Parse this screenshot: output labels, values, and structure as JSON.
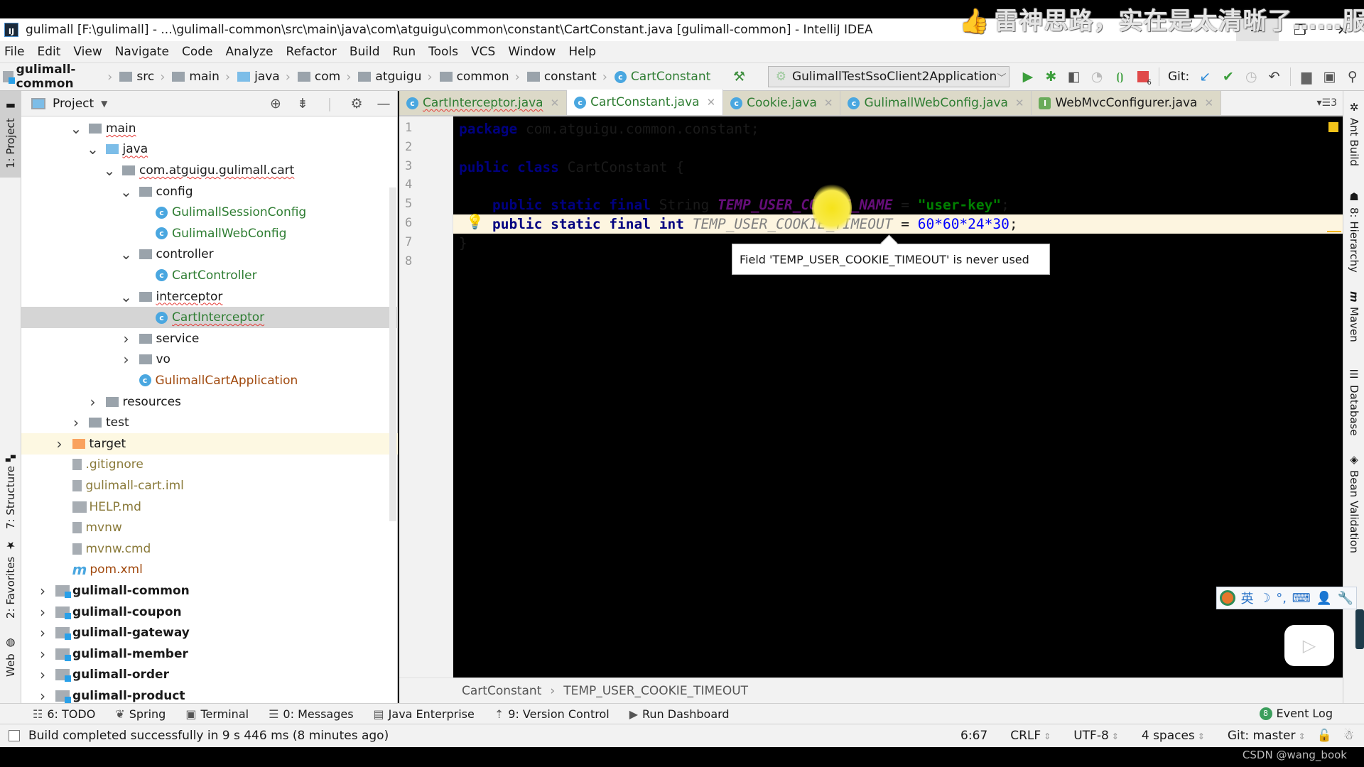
{
  "watermark": {
    "text": "雷神思路，实在是太清晰了……服了"
  },
  "window": {
    "title": "gulimall [F:\\gulimall] - ...\\gulimall-common\\src\\main\\java\\com\\atguigu\\common\\constant\\CartConstant.java [gulimall-common] - IntelliJ IDEA",
    "logo": "IJ"
  },
  "menu": [
    "File",
    "Edit",
    "View",
    "Navigate",
    "Code",
    "Analyze",
    "Refactor",
    "Build",
    "Run",
    "Tools",
    "VCS",
    "Window",
    "Help"
  ],
  "breadcrumbs": [
    {
      "label": "gulimall-common",
      "icon": "module-icon"
    },
    {
      "label": "src",
      "icon": "folder-icon"
    },
    {
      "label": "main",
      "icon": "folder-icon"
    },
    {
      "label": "java",
      "icon": "source-folder-icon"
    },
    {
      "label": "com",
      "icon": "package-icon"
    },
    {
      "label": "atguigu",
      "icon": "package-icon"
    },
    {
      "label": "common",
      "icon": "package-icon"
    },
    {
      "label": "constant",
      "icon": "package-icon"
    },
    {
      "label": "CartConstant",
      "icon": "class-icon"
    }
  ],
  "toolbar": {
    "run_config": "GulimallTestSsoClient2Application",
    "git_label": "Git:",
    "stop_badge": "6"
  },
  "left_stripe": [
    "1: Project",
    "7: Structure",
    "2: Favorites",
    "Web"
  ],
  "right_stripe": [
    "Ant Build",
    "8: Hierarchy",
    "Maven",
    "Database",
    "Bean Validation"
  ],
  "project": {
    "title": "Project",
    "tree": [
      {
        "label": "main",
        "type": "folder",
        "state": "expanded",
        "depth": 3,
        "wavy": true
      },
      {
        "label": "java",
        "type": "source-folder",
        "state": "expanded",
        "depth": 4,
        "wavy": true
      },
      {
        "label": "com.atguigu.gulimall.cart",
        "type": "package",
        "state": "expanded",
        "depth": 5,
        "wavy": true
      },
      {
        "label": "config",
        "type": "package",
        "state": "expanded",
        "depth": 6
      },
      {
        "label": "GulimallSessionConfig",
        "type": "class",
        "depth": 7
      },
      {
        "label": "GulimallWebConfig",
        "type": "class",
        "depth": 7
      },
      {
        "label": "controller",
        "type": "package",
        "state": "expanded",
        "depth": 6
      },
      {
        "label": "CartController",
        "type": "class",
        "depth": 7
      },
      {
        "label": "interceptor",
        "type": "package",
        "state": "expanded",
        "depth": 6,
        "wavy": true
      },
      {
        "label": "CartInterceptor",
        "type": "class",
        "depth": 7,
        "selected": true,
        "wavy": true
      },
      {
        "label": "service",
        "type": "package",
        "state": "collapsed",
        "depth": 6
      },
      {
        "label": "vo",
        "type": "package",
        "state": "collapsed",
        "depth": 6
      },
      {
        "label": "GulimallCartApplication",
        "type": "spring-app",
        "depth": 6
      },
      {
        "label": "resources",
        "type": "resources-folder",
        "state": "collapsed",
        "depth": 4
      },
      {
        "label": "test",
        "type": "folder",
        "state": "collapsed",
        "depth": 3
      },
      {
        "label": "target",
        "type": "excluded-folder",
        "state": "collapsed",
        "depth": 2,
        "highlighted": true
      },
      {
        "label": ".gitignore",
        "type": "file",
        "depth": 2
      },
      {
        "label": "gulimall-cart.iml",
        "type": "iml",
        "depth": 2
      },
      {
        "label": "HELP.md",
        "type": "md",
        "depth": 2
      },
      {
        "label": "mvnw",
        "type": "file",
        "depth": 2
      },
      {
        "label": "mvnw.cmd",
        "type": "file",
        "depth": 2
      },
      {
        "label": "pom.xml",
        "type": "maven",
        "depth": 2
      },
      {
        "label": "gulimall-common",
        "type": "module",
        "state": "collapsed",
        "depth": 1
      },
      {
        "label": "gulimall-coupon",
        "type": "module",
        "state": "collapsed",
        "depth": 1
      },
      {
        "label": "gulimall-gateway",
        "type": "module",
        "state": "collapsed",
        "depth": 1
      },
      {
        "label": "gulimall-member",
        "type": "module",
        "state": "collapsed",
        "depth": 1
      },
      {
        "label": "gulimall-order",
        "type": "module",
        "state": "collapsed",
        "depth": 1
      },
      {
        "label": "gulimall-product",
        "type": "module",
        "state": "collapsed",
        "depth": 1
      }
    ]
  },
  "tabs": [
    {
      "label": "CartInterceptor.java",
      "icon": "class",
      "active": false,
      "wavy": true
    },
    {
      "label": "CartConstant.java",
      "icon": "class",
      "active": true
    },
    {
      "label": "Cookie.java",
      "icon": "class",
      "active": false
    },
    {
      "label": "GulimallWebConfig.java",
      "icon": "class",
      "active": false
    },
    {
      "label": "WebMvcConfigurer.java",
      "icon": "interface",
      "active": false
    }
  ],
  "tab_overflow": "3",
  "code": {
    "line_numbers": [
      "1",
      "2",
      "3",
      "4",
      "5",
      "6",
      "7",
      "8"
    ],
    "lines": [
      [
        {
          "t": "package ",
          "c": "kw"
        },
        {
          "t": "com.atguigu.common.constant;",
          "c": ""
        }
      ],
      [],
      [
        {
          "t": "public class ",
          "c": "kw"
        },
        {
          "t": "CartConstant {",
          "c": ""
        }
      ],
      [],
      [
        {
          "t": "    public static final ",
          "c": "kw"
        },
        {
          "t": "String ",
          "c": ""
        },
        {
          "t": "TEMP_USER_COOKIE_NAME",
          "c": "cst"
        },
        {
          "t": " = ",
          "c": ""
        },
        {
          "t": "\"user-key\"",
          "c": "str"
        },
        {
          "t": ";",
          "c": ""
        }
      ],
      [
        {
          "t": "    public static final int ",
          "c": "kw"
        },
        {
          "t": "TEMP_USER_COOKIE_TIMEOUT",
          "c": "unused"
        },
        {
          "t": " = ",
          "c": ""
        },
        {
          "t": "60*60*24*30",
          "c": "num"
        },
        {
          "t": ";",
          "c": ""
        }
      ],
      [
        {
          "t": "}",
          "c": ""
        }
      ],
      []
    ],
    "current_line": 6
  },
  "tooltip": "Field 'TEMP_USER_COOKIE_TIMEOUT' is never used",
  "editor_breadcrumb": [
    "CartConstant",
    "TEMP_USER_COOKIE_TIMEOUT"
  ],
  "ime_bar": [
    "英",
    "☽",
    "°,",
    "⌨",
    "👤",
    "🔧"
  ],
  "tool_windows": [
    {
      "label": "6: TODO",
      "icon": "todo-icon"
    },
    {
      "label": "Spring",
      "icon": "spring-icon"
    },
    {
      "label": "Terminal",
      "icon": "terminal-icon"
    },
    {
      "label": "0: Messages",
      "icon": "messages-icon"
    },
    {
      "label": "Java Enterprise",
      "icon": "java-enterprise-icon"
    },
    {
      "label": "9: Version Control",
      "icon": "version-control-icon"
    },
    {
      "label": "Run Dashboard",
      "icon": "run-dashboard-icon"
    }
  ],
  "event_log": {
    "label": "Event Log",
    "count": "8"
  },
  "status": {
    "message": "Build completed successfully in 9 s 446 ms (8 minutes ago)",
    "position": "6:67",
    "line_sep": "CRLF",
    "encoding": "UTF-8",
    "indent": "4 spaces",
    "vcs": "Git: master"
  },
  "credit": "CSDN @wang_book"
}
